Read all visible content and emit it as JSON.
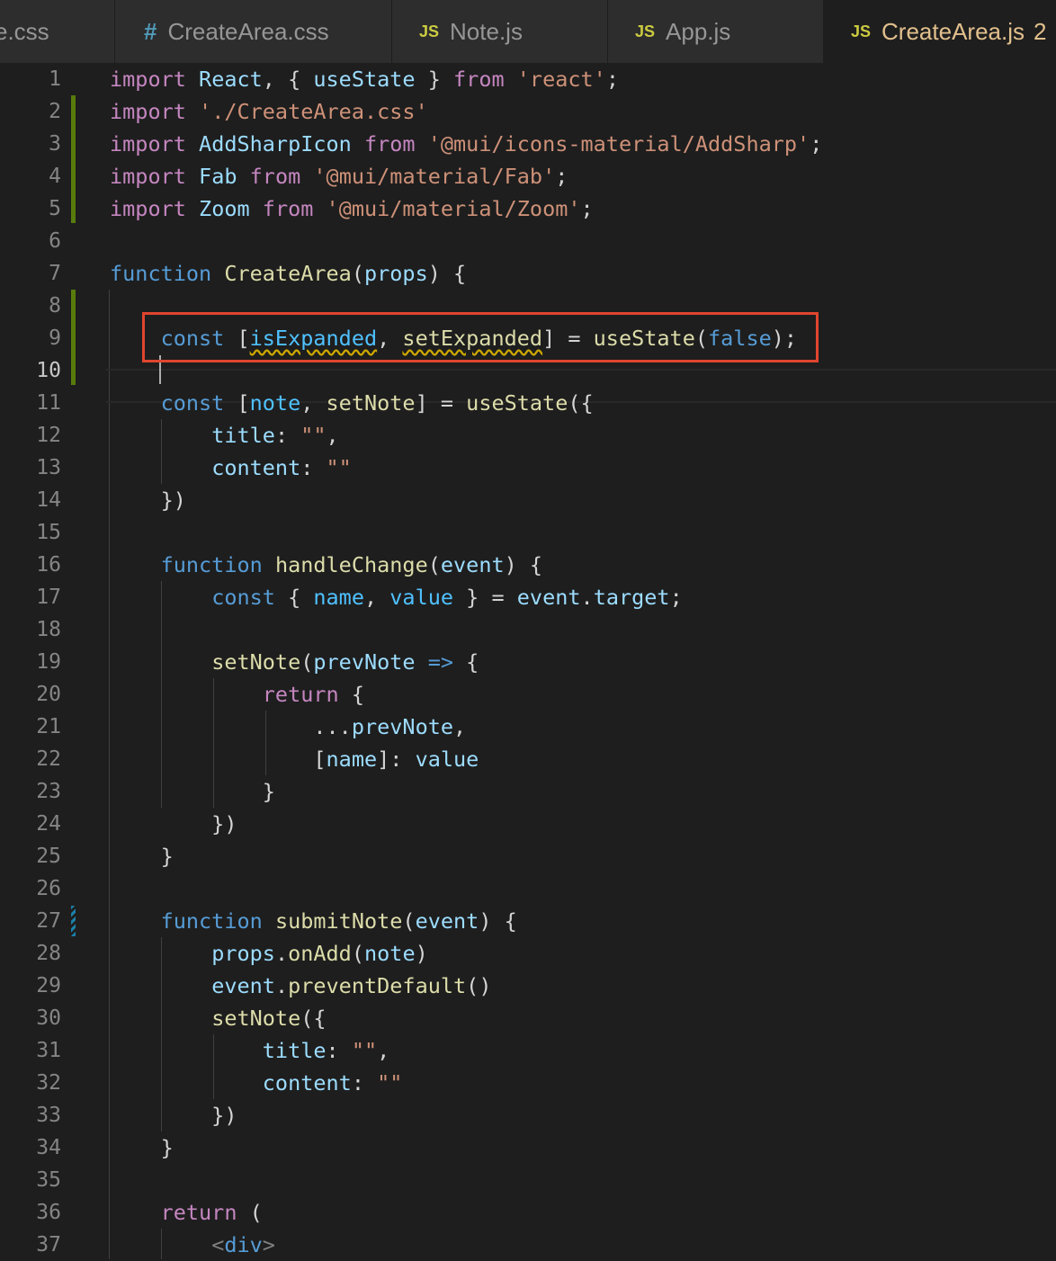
{
  "tabs": [
    {
      "icon": "css-icon",
      "label": "e.css",
      "active": false
    },
    {
      "icon": "#",
      "label": "CreateArea.css",
      "active": false
    },
    {
      "icon": "JS",
      "label": "Note.js",
      "active": false
    },
    {
      "icon": "JS",
      "label": "App.js",
      "active": false
    },
    {
      "icon": "JS",
      "label": "CreateArea.js",
      "badge": "2",
      "active": true
    }
  ],
  "editor": {
    "current_line": 10,
    "highlighted_line": 9,
    "lines": [
      {
        "n": "1",
        "tokens": [
          [
            "k",
            "import"
          ],
          [
            "p",
            " "
          ],
          [
            "v",
            "React"
          ],
          [
            "p",
            ", { "
          ],
          [
            "v",
            "useState"
          ],
          [
            "p",
            " } "
          ],
          [
            "k",
            "from"
          ],
          [
            "p",
            " "
          ],
          [
            "s",
            "'react'"
          ],
          [
            "p",
            ";"
          ]
        ]
      },
      {
        "n": "2",
        "tokens": [
          [
            "k",
            "import"
          ],
          [
            "p",
            " "
          ],
          [
            "s",
            "'./CreateArea.css'"
          ]
        ]
      },
      {
        "n": "3",
        "tokens": [
          [
            "k",
            "import"
          ],
          [
            "p",
            " "
          ],
          [
            "v",
            "AddSharpIcon"
          ],
          [
            "p",
            " "
          ],
          [
            "k",
            "from"
          ],
          [
            "p",
            " "
          ],
          [
            "s",
            "'@mui/icons-material/AddSharp'"
          ],
          [
            "p",
            ";"
          ]
        ]
      },
      {
        "n": "4",
        "tokens": [
          [
            "k",
            "import"
          ],
          [
            "p",
            " "
          ],
          [
            "v",
            "Fab"
          ],
          [
            "p",
            " "
          ],
          [
            "k",
            "from"
          ],
          [
            "p",
            " "
          ],
          [
            "s",
            "'@mui/material/Fab'"
          ],
          [
            "p",
            ";"
          ]
        ]
      },
      {
        "n": "5",
        "tokens": [
          [
            "k",
            "import"
          ],
          [
            "p",
            " "
          ],
          [
            "v",
            "Zoom"
          ],
          [
            "p",
            " "
          ],
          [
            "k",
            "from"
          ],
          [
            "p",
            " "
          ],
          [
            "s",
            "'@mui/material/Zoom'"
          ],
          [
            "p",
            ";"
          ]
        ]
      },
      {
        "n": "6",
        "tokens": []
      },
      {
        "n": "7",
        "tokens": [
          [
            "b",
            "function"
          ],
          [
            "p",
            " "
          ],
          [
            "f",
            "CreateArea"
          ],
          [
            "p",
            "("
          ],
          [
            "v",
            "props"
          ],
          [
            "p",
            ") {"
          ]
        ]
      },
      {
        "n": "8",
        "tokens": []
      },
      {
        "n": "9",
        "tokens": [
          [
            "p",
            "    "
          ],
          [
            "b",
            "const"
          ],
          [
            "p",
            " ["
          ],
          [
            "c squig",
            "isExpanded"
          ],
          [
            "p",
            ", "
          ],
          [
            "f squig",
            "setExpanded"
          ],
          [
            "p",
            "] = "
          ],
          [
            "f",
            "useState"
          ],
          [
            "p",
            "("
          ],
          [
            "b",
            "false"
          ],
          [
            "p",
            ");"
          ]
        ]
      },
      {
        "n": "10",
        "tokens": []
      },
      {
        "n": "11",
        "tokens": [
          [
            "p",
            "    "
          ],
          [
            "b",
            "const"
          ],
          [
            "p",
            " ["
          ],
          [
            "c",
            "note"
          ],
          [
            "p",
            ", "
          ],
          [
            "f",
            "setNote"
          ],
          [
            "p",
            "] = "
          ],
          [
            "f",
            "useState"
          ],
          [
            "p",
            "({"
          ]
        ]
      },
      {
        "n": "12",
        "tokens": [
          [
            "p",
            "        "
          ],
          [
            "v",
            "title"
          ],
          [
            "p",
            ": "
          ],
          [
            "s",
            "\"\""
          ],
          [
            "p",
            ","
          ]
        ]
      },
      {
        "n": "13",
        "tokens": [
          [
            "p",
            "        "
          ],
          [
            "v",
            "content"
          ],
          [
            "p",
            ": "
          ],
          [
            "s",
            "\"\""
          ]
        ]
      },
      {
        "n": "14",
        "tokens": [
          [
            "p",
            "    })"
          ]
        ]
      },
      {
        "n": "15",
        "tokens": []
      },
      {
        "n": "16",
        "tokens": [
          [
            "p",
            "    "
          ],
          [
            "b",
            "function"
          ],
          [
            "p",
            " "
          ],
          [
            "f",
            "handleChange"
          ],
          [
            "p",
            "("
          ],
          [
            "v",
            "event"
          ],
          [
            "p",
            ") {"
          ]
        ]
      },
      {
        "n": "17",
        "tokens": [
          [
            "p",
            "        "
          ],
          [
            "b",
            "const"
          ],
          [
            "p",
            " { "
          ],
          [
            "c",
            "name"
          ],
          [
            "p",
            ", "
          ],
          [
            "c",
            "value"
          ],
          [
            "p",
            " } = "
          ],
          [
            "v",
            "event"
          ],
          [
            "p",
            "."
          ],
          [
            "v",
            "target"
          ],
          [
            "p",
            ";"
          ]
        ]
      },
      {
        "n": "18",
        "tokens": []
      },
      {
        "n": "19",
        "tokens": [
          [
            "p",
            "        "
          ],
          [
            "f",
            "setNote"
          ],
          [
            "p",
            "("
          ],
          [
            "v",
            "prevNote"
          ],
          [
            "p",
            " "
          ],
          [
            "b",
            "=>"
          ],
          [
            "p",
            " {"
          ]
        ]
      },
      {
        "n": "20",
        "tokens": [
          [
            "p",
            "            "
          ],
          [
            "k",
            "return"
          ],
          [
            "p",
            " {"
          ]
        ]
      },
      {
        "n": "21",
        "tokens": [
          [
            "p",
            "                ..."
          ],
          [
            "v",
            "prevNote"
          ],
          [
            "p",
            ","
          ]
        ]
      },
      {
        "n": "22",
        "tokens": [
          [
            "p",
            "                ["
          ],
          [
            "v",
            "name"
          ],
          [
            "p",
            "]: "
          ],
          [
            "v",
            "value"
          ]
        ]
      },
      {
        "n": "23",
        "tokens": [
          [
            "p",
            "            }"
          ]
        ]
      },
      {
        "n": "24",
        "tokens": [
          [
            "p",
            "        })"
          ]
        ]
      },
      {
        "n": "25",
        "tokens": [
          [
            "p",
            "    }"
          ]
        ]
      },
      {
        "n": "26",
        "tokens": []
      },
      {
        "n": "27",
        "tokens": [
          [
            "p",
            "    "
          ],
          [
            "b",
            "function"
          ],
          [
            "p",
            " "
          ],
          [
            "f",
            "submitNote"
          ],
          [
            "p",
            "("
          ],
          [
            "v",
            "event"
          ],
          [
            "p",
            ") {"
          ]
        ]
      },
      {
        "n": "28",
        "tokens": [
          [
            "p",
            "        "
          ],
          [
            "v",
            "props"
          ],
          [
            "p",
            "."
          ],
          [
            "f",
            "onAdd"
          ],
          [
            "p",
            "("
          ],
          [
            "v",
            "note"
          ],
          [
            "p",
            ")"
          ]
        ]
      },
      {
        "n": "29",
        "tokens": [
          [
            "p",
            "        "
          ],
          [
            "v",
            "event"
          ],
          [
            "p",
            "."
          ],
          [
            "f",
            "preventDefault"
          ],
          [
            "p",
            "()"
          ]
        ]
      },
      {
        "n": "30",
        "tokens": [
          [
            "p",
            "        "
          ],
          [
            "f",
            "setNote"
          ],
          [
            "p",
            "({"
          ]
        ]
      },
      {
        "n": "31",
        "tokens": [
          [
            "p",
            "            "
          ],
          [
            "v",
            "title"
          ],
          [
            "p",
            ": "
          ],
          [
            "s",
            "\"\""
          ],
          [
            "p",
            ","
          ]
        ]
      },
      {
        "n": "32",
        "tokens": [
          [
            "p",
            "            "
          ],
          [
            "v",
            "content"
          ],
          [
            "p",
            ": "
          ],
          [
            "s",
            "\"\""
          ]
        ]
      },
      {
        "n": "33",
        "tokens": [
          [
            "p",
            "        })"
          ]
        ]
      },
      {
        "n": "34",
        "tokens": [
          [
            "p",
            "    }"
          ]
        ]
      },
      {
        "n": "35",
        "tokens": []
      },
      {
        "n": "36",
        "tokens": [
          [
            "p",
            "    "
          ],
          [
            "k",
            "return"
          ],
          [
            "p",
            " ("
          ]
        ]
      },
      {
        "n": "37",
        "tokens": [
          [
            "p",
            "        "
          ],
          [
            "g",
            "<"
          ],
          [
            "b",
            "div"
          ],
          [
            "g",
            ">"
          ]
        ]
      }
    ]
  }
}
